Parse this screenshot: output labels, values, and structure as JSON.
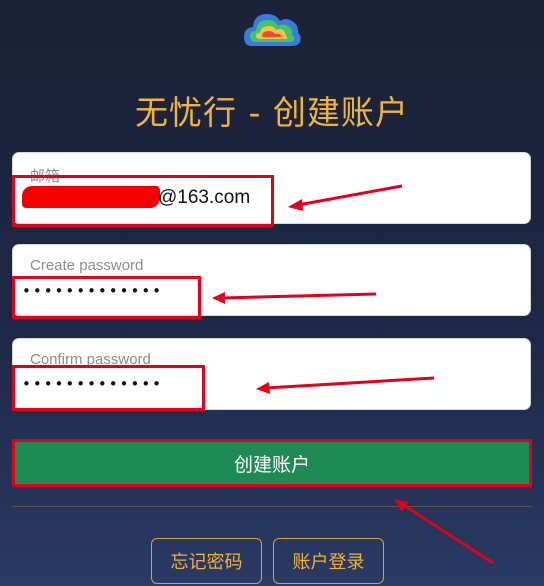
{
  "app": {
    "title": "无忧行 - 创建账户"
  },
  "form": {
    "email": {
      "label": "邮箱",
      "value_suffix": "@163.com"
    },
    "password": {
      "label": "Create password",
      "value": "•••••••••••••"
    },
    "confirm": {
      "label": "Confirm password",
      "value": "•••••••••••••"
    },
    "submit_label": "创建账户"
  },
  "links": {
    "forgot_label": "忘记密码",
    "login_label": "账户登录"
  },
  "icons": {
    "logo": "cloud-logo-icon"
  },
  "colors": {
    "accent": "#f2b33b",
    "submit": "#1f8a54",
    "annotation": "#e3001c"
  }
}
